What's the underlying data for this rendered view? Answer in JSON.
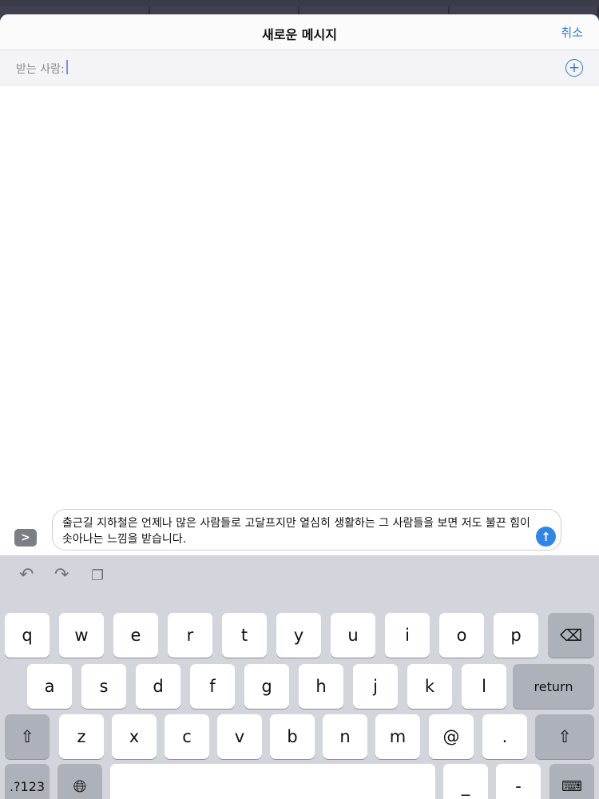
{
  "header": {
    "title": "새로운 메시지",
    "cancel_label": "취소"
  },
  "recipient": {
    "label": "받는 사람:",
    "value": "",
    "add_icon": "plus-circle-icon"
  },
  "composer": {
    "message_text": "출근길 지하철은 언제나 많은 사람들로 고달프지만 열심히 생활하는 그 사람들을 보면 저도 불끈 힘이 솟아나는 느낌을 받습니다.",
    "expand_icon": "chevron-right-icon",
    "send_icon": "arrow-up-icon"
  },
  "keyboard": {
    "shortcuts": [
      "undo-icon",
      "redo-icon",
      "paste-icon"
    ],
    "row1": [
      "q",
      "w",
      "e",
      "r",
      "t",
      "y",
      "u",
      "i",
      "o",
      "p"
    ],
    "row2": [
      "a",
      "s",
      "d",
      "f",
      "g",
      "h",
      "j",
      "k",
      "l"
    ],
    "row3": [
      "z",
      "x",
      "c",
      "v",
      "b",
      "n",
      "m",
      "@",
      "."
    ],
    "return_label": "return",
    "numbers_label": ".?123",
    "underscore_label": "_",
    "dash_label": "-"
  },
  "colors": {
    "accent": "#2f7bd6",
    "send": "#2f86e8",
    "keyboard_bg": "#d2d5db"
  }
}
